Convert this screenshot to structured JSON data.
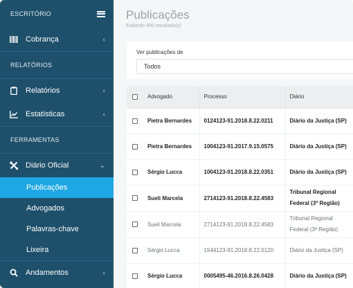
{
  "sidebar": {
    "section_escritorio": "ESCRITÓRIO",
    "menu_icon": "hamburger-icon",
    "cobranca": {
      "label": "Cobrança",
      "icon": "barcode-icon"
    },
    "section_relatorios": "RELATÓRIOS",
    "relatorios": {
      "label": "Relatórios",
      "icon": "clipboard-icon"
    },
    "estatisticas": {
      "label": "Estatísticas",
      "icon": "chart-line-icon"
    },
    "section_ferramentas": "FERRAMENTAS",
    "diario_oficial": {
      "label": "Diário Oficial",
      "icon": "tools-icon"
    },
    "subitems": [
      "Publicações",
      "Advogados",
      "Palavras-chave",
      "Lixeira"
    ],
    "active_subitem": "Publicações",
    "andamentos": {
      "label": "Andamentos",
      "icon": "search-icon"
    }
  },
  "main": {
    "title": "Publicações",
    "subtitle": "Exibindo 400 resultado(s)",
    "filter": {
      "label": "Ver publicações de",
      "value": "Todos"
    },
    "table": {
      "headers": {
        "advogado": "Advogado",
        "processo": "Processo",
        "diario": "Diário"
      },
      "rows": [
        {
          "advogado": "Pietra Bernardes",
          "processo": "0124123-91.2018.8.22.0211",
          "diario": [
            "Diário da Justiça (SP)"
          ],
          "style": "bold"
        },
        {
          "advogado": "Pietra Bernardes",
          "processo": "1004123-91.2017.9.15.0575",
          "diario": [
            "Diário da Justiça (SP)"
          ],
          "style": "bold"
        },
        {
          "advogado": "Sérgio Lucca",
          "processo": "1004123-91.2018.8.22.0351",
          "diario": [
            "Diário da Justiça (SP)"
          ],
          "style": "bold"
        },
        {
          "advogado": "Sueli Marcela",
          "processo": "2714123-91.2018.8.22.4583",
          "diario": [
            "Tribunal Regional",
            "Federal (3ª Região)"
          ],
          "style": "bold"
        },
        {
          "advogado": "Sueli Marcela",
          "processo": "2714123-91.2018.8.22.4583",
          "diario": [
            "Tribunal Regional",
            "Federal (3ª Região)"
          ],
          "style": "light"
        },
        {
          "advogado": "Sérgio Lucca",
          "processo": "1544123-91.2018.8.22.0120",
          "diario": [
            "Diário da Justiça (SP)"
          ],
          "style": "light"
        },
        {
          "advogado": "Sérgio Lucca",
          "processo": "0005495-46.2016.8.26.0428",
          "diario": [
            "Diário da Justiça (SP)"
          ],
          "style": "bold"
        }
      ]
    }
  },
  "colors": {
    "sidebar_bg": "#1e4f6b",
    "active_bg": "#1ea7e2",
    "main_bg": "#f4f6f8"
  }
}
